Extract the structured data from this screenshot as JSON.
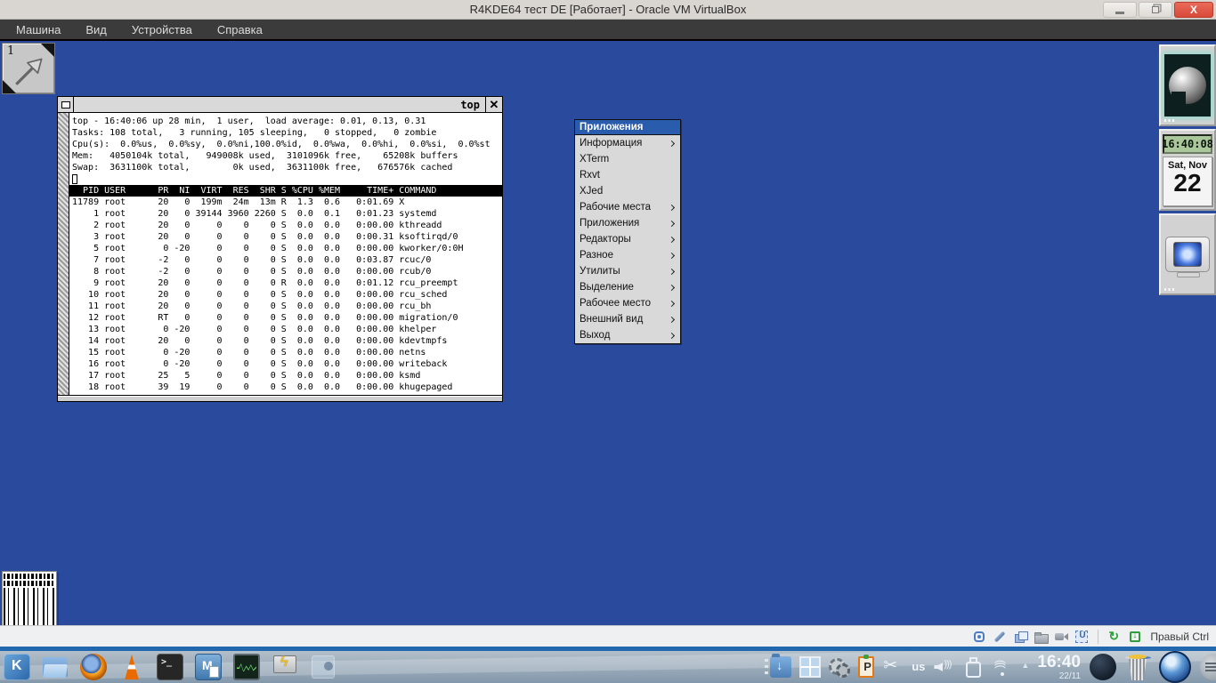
{
  "window": {
    "title": "R4KDE64 тест DE [Работает] - Oracle VM VirtualBox",
    "controls": [
      "minimize",
      "restore",
      "close"
    ]
  },
  "menubar": {
    "items": [
      "Машина",
      "Вид",
      "Устройства",
      "Справка"
    ]
  },
  "guest": {
    "pager_label": "1",
    "top_window": {
      "title": "top",
      "summary_lines": [
        "top - 16:40:06 up 28 min,  1 user,  load average: 0.01, 0.13, 0.31",
        "Tasks: 108 total,   3 running, 105 sleeping,   0 stopped,   0 zombie",
        "Cpu(s):  0.0%us,  0.0%sy,  0.0%ni,100.0%id,  0.0%wa,  0.0%hi,  0.0%si,  0.0%st",
        "Mem:   4050104k total,   949008k used,  3101096k free,    65208k buffers",
        "Swap:  3631100k total,        0k used,  3631100k free,   676576k cached"
      ],
      "columns": [
        "PID",
        "USER",
        "PR",
        "NI",
        "VIRT",
        "RES",
        "SHR",
        "S",
        "%CPU",
        "%MEM",
        "TIME+",
        "COMMAND"
      ],
      "processes": [
        [
          "11789",
          "root",
          "20",
          "0",
          "199m",
          "24m",
          "13m",
          "R",
          "1.3",
          "0.6",
          "0:01.69",
          "X"
        ],
        [
          "1",
          "root",
          "20",
          "0",
          "39144",
          "3960",
          "2260",
          "S",
          "0.0",
          "0.1",
          "0:01.23",
          "systemd"
        ],
        [
          "2",
          "root",
          "20",
          "0",
          "0",
          "0",
          "0",
          "S",
          "0.0",
          "0.0",
          "0:00.00",
          "kthreadd"
        ],
        [
          "3",
          "root",
          "20",
          "0",
          "0",
          "0",
          "0",
          "S",
          "0.0",
          "0.0",
          "0:00.31",
          "ksoftirqd/0"
        ],
        [
          "5",
          "root",
          "0",
          "-20",
          "0",
          "0",
          "0",
          "S",
          "0.0",
          "0.0",
          "0:00.00",
          "kworker/0:0H"
        ],
        [
          "7",
          "root",
          "-2",
          "0",
          "0",
          "0",
          "0",
          "S",
          "0.0",
          "0.0",
          "0:03.87",
          "rcuc/0"
        ],
        [
          "8",
          "root",
          "-2",
          "0",
          "0",
          "0",
          "0",
          "S",
          "0.0",
          "0.0",
          "0:00.00",
          "rcub/0"
        ],
        [
          "9",
          "root",
          "20",
          "0",
          "0",
          "0",
          "0",
          "R",
          "0.0",
          "0.0",
          "0:01.12",
          "rcu_preempt"
        ],
        [
          "10",
          "root",
          "20",
          "0",
          "0",
          "0",
          "0",
          "S",
          "0.0",
          "0.0",
          "0:00.00",
          "rcu_sched"
        ],
        [
          "11",
          "root",
          "20",
          "0",
          "0",
          "0",
          "0",
          "S",
          "0.0",
          "0.0",
          "0:00.00",
          "rcu_bh"
        ],
        [
          "12",
          "root",
          "RT",
          "0",
          "0",
          "0",
          "0",
          "S",
          "0.0",
          "0.0",
          "0:00.00",
          "migration/0"
        ],
        [
          "13",
          "root",
          "0",
          "-20",
          "0",
          "0",
          "0",
          "S",
          "0.0",
          "0.0",
          "0:00.00",
          "khelper"
        ],
        [
          "14",
          "root",
          "20",
          "0",
          "0",
          "0",
          "0",
          "S",
          "0.0",
          "0.0",
          "0:00.00",
          "kdevtmpfs"
        ],
        [
          "15",
          "root",
          "0",
          "-20",
          "0",
          "0",
          "0",
          "S",
          "0.0",
          "0.0",
          "0:00.00",
          "netns"
        ],
        [
          "16",
          "root",
          "0",
          "-20",
          "0",
          "0",
          "0",
          "S",
          "0.0",
          "0.0",
          "0:00.00",
          "writeback"
        ],
        [
          "17",
          "root",
          "25",
          "5",
          "0",
          "0",
          "0",
          "S",
          "0.0",
          "0.0",
          "0:00.00",
          "ksmd"
        ],
        [
          "18",
          "root",
          "39",
          "19",
          "0",
          "0",
          "0",
          "S",
          "0.0",
          "0.0",
          "0:00.00",
          "khugepaged"
        ]
      ]
    },
    "apps_menu": {
      "title": "Приложения",
      "items": [
        {
          "label": "Информация",
          "submenu": true
        },
        {
          "label": "XTerm",
          "submenu": false
        },
        {
          "label": "Rxvt",
          "submenu": false
        },
        {
          "label": "XJed",
          "submenu": false
        },
        {
          "label": "Рабочие места",
          "submenu": true
        },
        {
          "label": "Приложения",
          "submenu": true
        },
        {
          "label": "Редакторы",
          "submenu": true
        },
        {
          "label": "Разное",
          "submenu": true
        },
        {
          "label": "Утилиты",
          "submenu": true
        },
        {
          "label": "Выделение",
          "submenu": true
        },
        {
          "label": "Рабочее место",
          "submenu": true
        },
        {
          "label": "Внешний вид",
          "submenu": true
        },
        {
          "label": "Выход",
          "submenu": true
        }
      ]
    },
    "dock": {
      "clock_time": "16:40:08",
      "clock_date_top": "Sat, Nov",
      "clock_date_day": "22"
    }
  },
  "statusbar": {
    "device_icons": [
      "hard-disk-icon",
      "optical-drive-icon",
      "virtual-screens-icon",
      "shared-folder-icon",
      "video-capture-icon",
      "usb-icon"
    ],
    "state_icons": [
      "network-icon",
      "autoresize-icon"
    ],
    "host_key_label": "Правый Ctrl"
  },
  "taskbar": {
    "launcher_icons": [
      "kde-menu-icon",
      "file-manager-icon",
      "firefox-icon",
      "vlc-icon",
      "terminal-icon",
      "text-editor-icon",
      "system-monitor-icon",
      "remote-desktop-icon",
      "inactive-window-icon"
    ],
    "tray_icons": [
      "downloads-folder-icon",
      "pager-icon",
      "gears-icon",
      "clipboard-icon",
      "scissors-icon",
      "keyboard-layout",
      "volume-icon",
      "usb-device-icon",
      "wifi-icon",
      "tray-expand-icon"
    ],
    "keyboard_layout": "us",
    "clock_time": "16:40",
    "clock_date": "22/11",
    "right_icons": [
      "app-circle-icon",
      "trash-icon",
      "launcher-orb-icon",
      "edge-menu-icon"
    ]
  },
  "colors": {
    "desktop": "#2a4a9d",
    "menu_title": "#2a5cad",
    "close_button": "#d84a3a",
    "lcd": "#a9c79b",
    "taskbar_stripe": "#2168ae"
  }
}
